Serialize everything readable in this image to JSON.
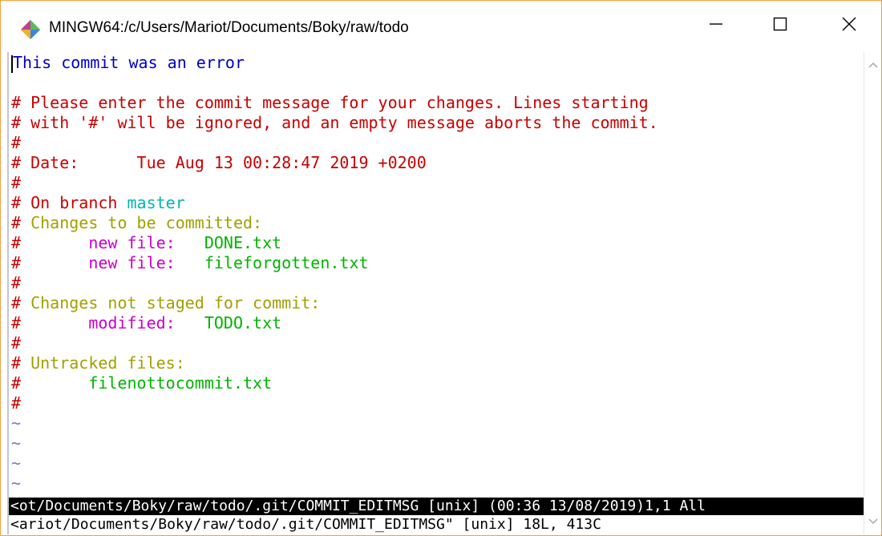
{
  "window": {
    "title": "MINGW64:/c/Users/Mariot/Documents/Boky/raw/todo",
    "minimize_icon": "minimize-icon",
    "maximize_icon": "maximize-icon",
    "close_icon": "close-icon",
    "app_icon": "git-bash-icon"
  },
  "colors": {
    "blue": "#0000c8",
    "red": "#c80000",
    "olive": "#a0a000",
    "magenta": "#c800c8",
    "green": "#00b400",
    "cyan": "#00b4b4",
    "tilde": "#7878c8"
  },
  "editor": {
    "lines": [
      {
        "segments": [
          {
            "text": "This commit was an error",
            "color": "blue"
          }
        ]
      },
      {
        "segments": []
      },
      {
        "segments": [
          {
            "text": "# Please enter the commit message for your changes. Lines starting",
            "color": "red"
          }
        ]
      },
      {
        "segments": [
          {
            "text": "# with '#' will be ignored, and an empty message aborts the commit.",
            "color": "red"
          }
        ]
      },
      {
        "segments": [
          {
            "text": "#",
            "color": "red"
          }
        ]
      },
      {
        "segments": [
          {
            "text": "# Date:      Tue Aug 13 00:28:47 2019 +0200",
            "color": "red"
          }
        ]
      },
      {
        "segments": [
          {
            "text": "#",
            "color": "red"
          }
        ]
      },
      {
        "segments": [
          {
            "text": "# On branch ",
            "color": "red"
          },
          {
            "text": "master",
            "color": "cyan"
          }
        ]
      },
      {
        "segments": [
          {
            "text": "# ",
            "color": "red"
          },
          {
            "text": "Changes to be committed:",
            "color": "olive"
          }
        ]
      },
      {
        "segments": [
          {
            "text": "#       ",
            "color": "red"
          },
          {
            "text": "new file:   ",
            "color": "magenta"
          },
          {
            "text": "DONE.txt",
            "color": "green"
          }
        ]
      },
      {
        "segments": [
          {
            "text": "#       ",
            "color": "red"
          },
          {
            "text": "new file:   ",
            "color": "magenta"
          },
          {
            "text": "fileforgotten.txt",
            "color": "green"
          }
        ]
      },
      {
        "segments": [
          {
            "text": "#",
            "color": "red"
          }
        ]
      },
      {
        "segments": [
          {
            "text": "# ",
            "color": "red"
          },
          {
            "text": "Changes not staged for commit:",
            "color": "olive"
          }
        ]
      },
      {
        "segments": [
          {
            "text": "#       ",
            "color": "red"
          },
          {
            "text": "modified:   ",
            "color": "magenta"
          },
          {
            "text": "TODO.txt",
            "color": "green"
          }
        ]
      },
      {
        "segments": [
          {
            "text": "#",
            "color": "red"
          }
        ]
      },
      {
        "segments": [
          {
            "text": "# ",
            "color": "red"
          },
          {
            "text": "Untracked files:",
            "color": "olive"
          }
        ]
      },
      {
        "segments": [
          {
            "text": "#       ",
            "color": "red"
          },
          {
            "text": "filenottocommit.txt",
            "color": "green"
          }
        ]
      },
      {
        "segments": [
          {
            "text": "#",
            "color": "red"
          }
        ]
      },
      {
        "segments": [
          {
            "text": "~",
            "color": "tilde"
          }
        ]
      },
      {
        "segments": [
          {
            "text": "~",
            "color": "tilde"
          }
        ]
      },
      {
        "segments": [
          {
            "text": "~",
            "color": "tilde"
          }
        ]
      },
      {
        "segments": [
          {
            "text": "~",
            "color": "tilde"
          }
        ]
      }
    ],
    "status_line": "<ot/Documents/Boky/raw/todo/.git/COMMIT_EDITMSG [unix] (00:36 13/08/2019)1,1 All",
    "message_line": "<ariot/Documents/Boky/raw/todo/.git/COMMIT_EDITMSG\" [unix] 18L, 413C"
  }
}
